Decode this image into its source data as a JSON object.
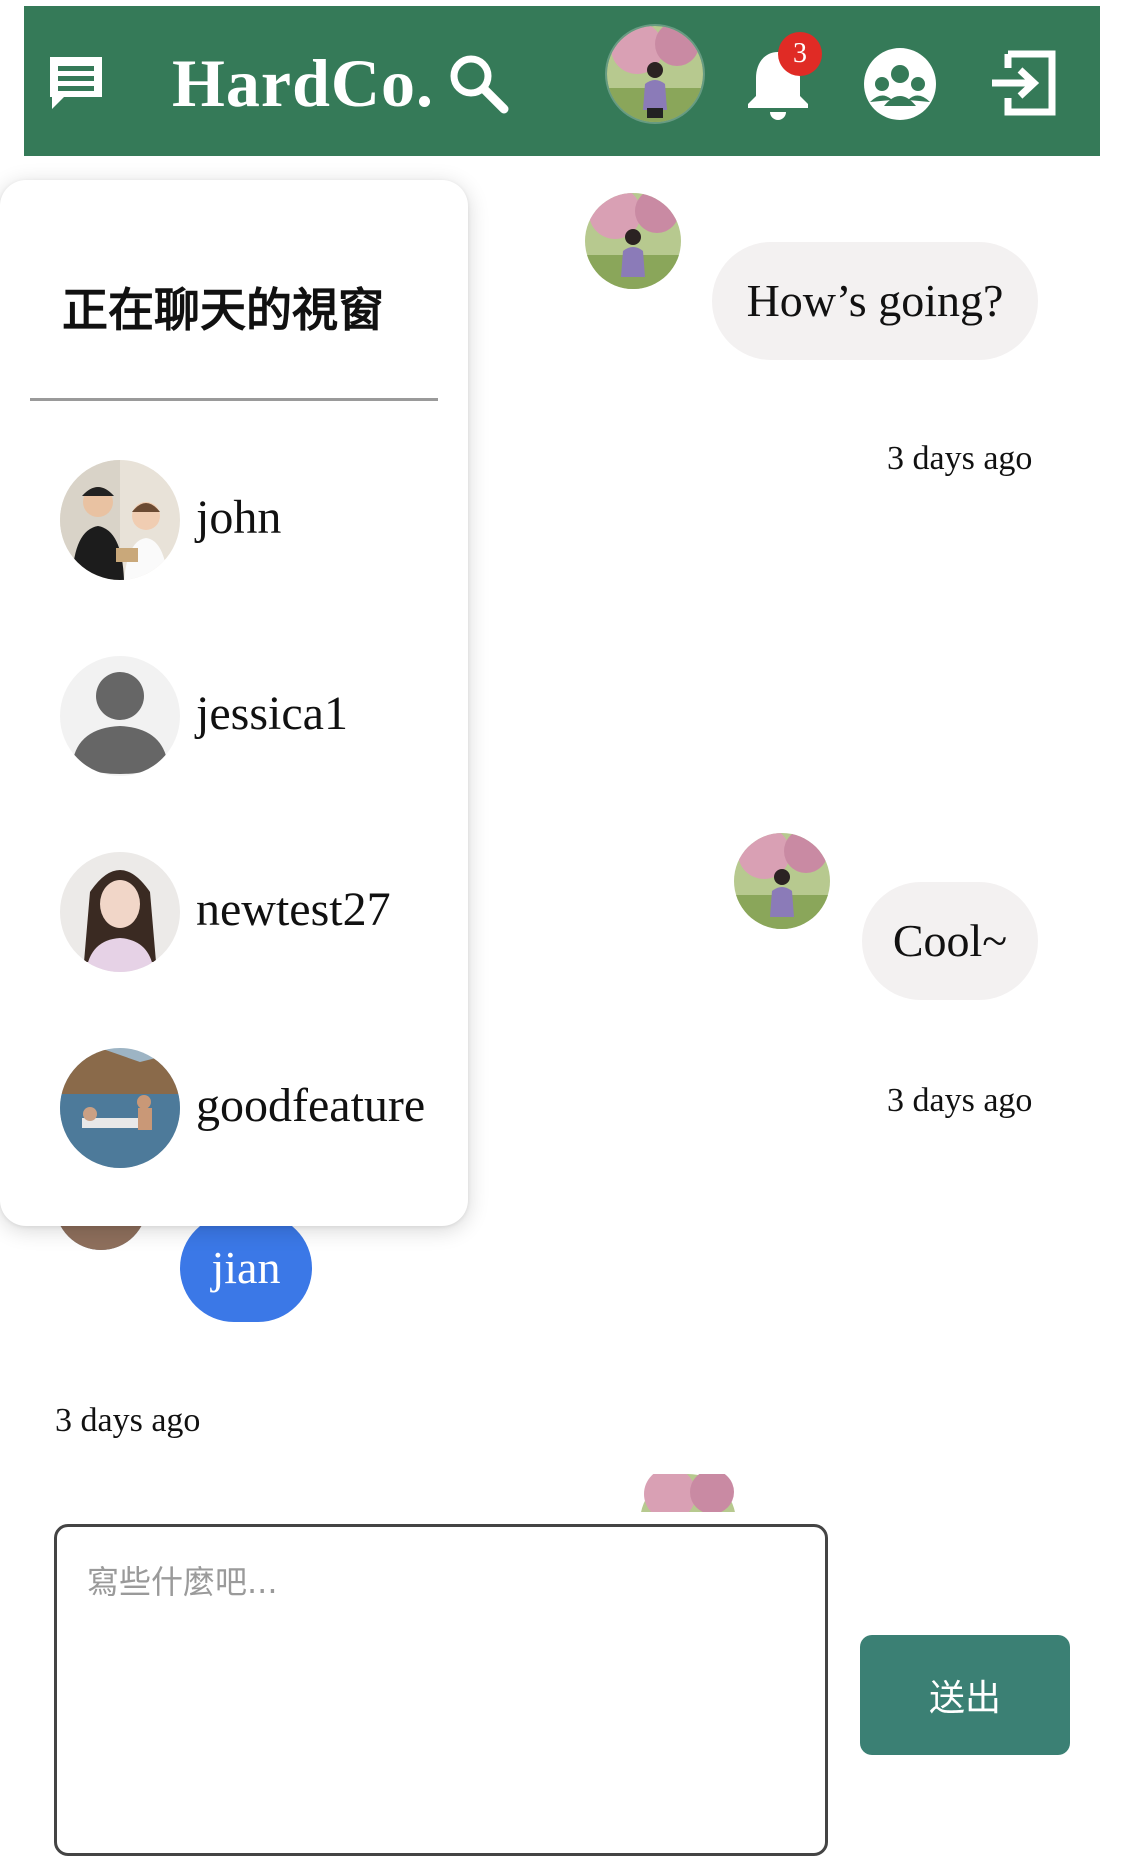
{
  "header": {
    "brand": "HardCo.",
    "notification_count": "3",
    "icons": [
      "chat-menu-icon",
      "search-icon",
      "bell-icon",
      "group-icon",
      "logout-icon"
    ]
  },
  "chat_panel": {
    "title": "正在聊天的視窗",
    "items": [
      {
        "name": "john"
      },
      {
        "name": "jessica1"
      },
      {
        "name": "newtest27"
      },
      {
        "name": "goodfeature"
      }
    ]
  },
  "messages": [
    {
      "text": "How’s going?",
      "time": "3 days ago"
    },
    {
      "text": "Cool~",
      "time": "3 days ago"
    },
    {
      "text": "jian",
      "time": "3 days ago"
    }
  ],
  "composer": {
    "placeholder": "寫些什麼吧...",
    "send_label": "送出"
  },
  "colors": {
    "header": "#357a58",
    "send_button": "#3b8074",
    "my_bubble": "#3b78e7",
    "other_bubble": "#f3f1f1",
    "badge": "#e02b25"
  }
}
